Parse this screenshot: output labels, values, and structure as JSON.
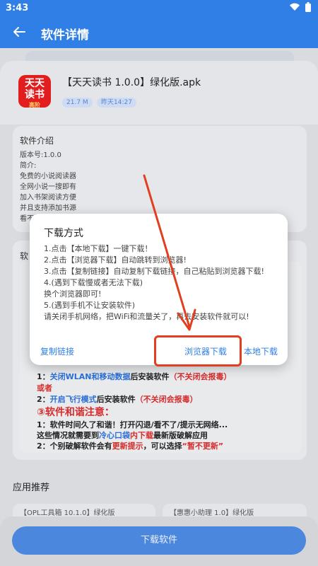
{
  "status": {
    "time": "3:43"
  },
  "header": {
    "title": "软件详情"
  },
  "app": {
    "icon_text_1": "天天",
    "icon_text_2": "读书",
    "icon_sub": "高阶",
    "name": "【天天读书 1.0.0】绿化版.apk",
    "size": "21.7 M",
    "date": "昨天14:27"
  },
  "intro": {
    "title": "软件介绍",
    "lines": [
      "版本号:1.0.0",
      "简介:",
      "免费的小说阅读器",
      "全网小说一搜即有",
      "加入书架阅读方便",
      "并且支持添加书源",
      "看不见的小说阅读"
    ]
  },
  "lower": {
    "header": "软",
    "rule1_prefix": "1：",
    "rule1_blue": "关闭WLAN和移动数据",
    "rule1_mid": "后安装软件",
    "rule1_red": "（不关闭会报毒）",
    "rule_or": "或者",
    "rule2_prefix": "2：",
    "rule2_blue": "开启飞行模式",
    "rule2_mid": "后安装软件",
    "rule2_red": "（不关闭会报毒）",
    "section3": "③软件和谐注意：",
    "note1": "1：软件时间久了和谐！打开闪退/看不了/提示无网络...",
    "note2_a": "这些情况就需要到",
    "note2_blue": "冷心口袋",
    "note2_red": "内下载",
    "note2_b": "最新版破解应用",
    "note3_a": "2：个别破解软件会有",
    "note3_red": "更新提示",
    "note3_b": "，可以选择",
    "note3_red2": "“暂不更新”"
  },
  "recommend": {
    "title": "应用推荐",
    "item1": "【OPL工具箱 10.1.0】绿化版",
    "item2": "【惠惠小助理 1.0】绿化版"
  },
  "bottom": {
    "download_label": "下载软件"
  },
  "dialog": {
    "title": "下载方式",
    "lines": [
      "1.点击【本地下载】一键下载！",
      "2.点击【浏览器下载】自动跳转到浏览器!",
      "3.点击【复制链接】自动复制下载链接，自己粘贴到浏览器下载!",
      "4.(遇到下载慢或者无法下载)",
      "换个浏览器即可!",
      "5.(遇到手机不让安装软件)",
      "请关闭手机网络，把WiFi和流量关了，再去安装软件就可以!"
    ],
    "copy_link": "复制链接",
    "browser_download": "浏览器下载",
    "local_download": "本地下载"
  },
  "colors": {
    "accent": "#2f7fe6",
    "annotation": "#e0401f"
  }
}
